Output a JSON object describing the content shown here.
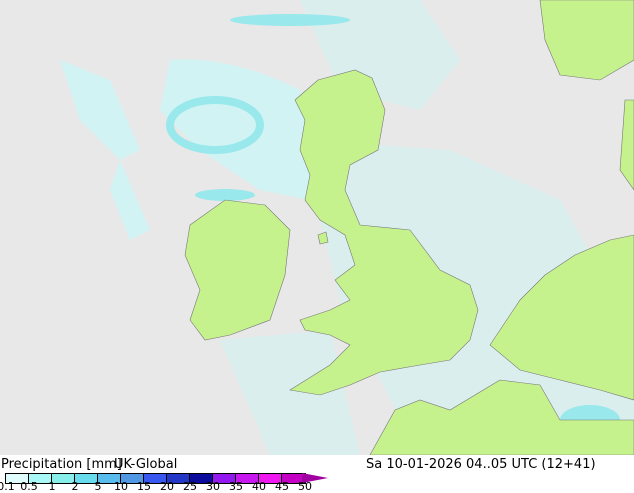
{
  "title": "Precipitation [mm]",
  "model": "UK-Global",
  "valid_time": "Sa 10-01-2026 04..05 UTC (12+41)",
  "legend": {
    "ticks": [
      "0.1",
      "0.5",
      "1",
      "2",
      "5",
      "10",
      "15",
      "20",
      "25",
      "30",
      "35",
      "40",
      "45",
      "50"
    ],
    "colors": [
      "#e0fcfc",
      "#a8f8f8",
      "#88eeea",
      "#68dcec",
      "#58bcec",
      "#5098e4",
      "#3858f0",
      "#2438c8",
      "#0c0c9c",
      "#9418f0",
      "#c818f0",
      "#f018f0",
      "#c400c4",
      "#a000a0"
    ]
  },
  "map_colors": {
    "sea": "#e8e8e8",
    "land": "#c6f28e",
    "precip_light": "#c8f4f4",
    "precip_mid": "#90e8ec"
  }
}
